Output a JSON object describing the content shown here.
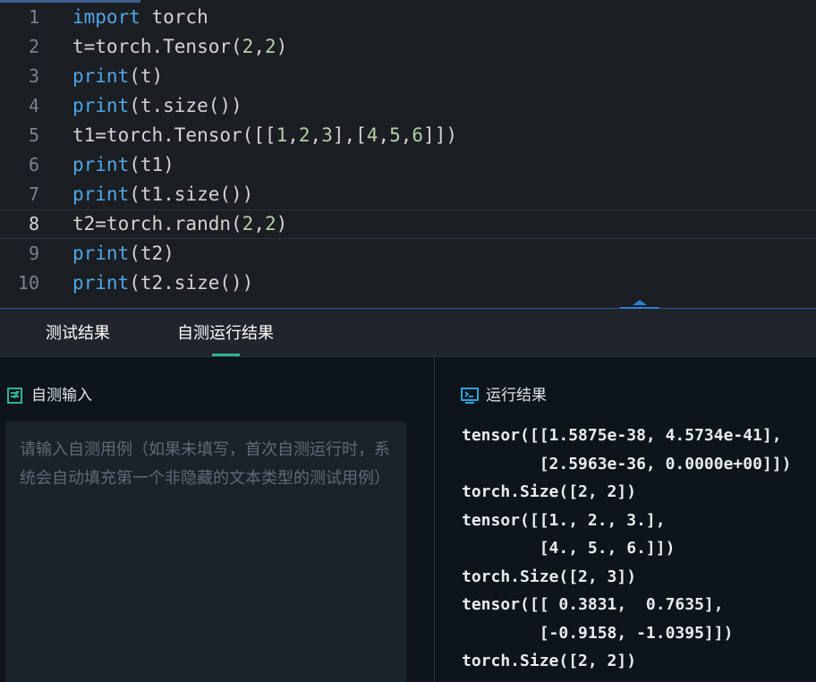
{
  "editor": {
    "lines": [
      {
        "num": "1",
        "tokens": [
          {
            "t": "import",
            "c": "kw"
          },
          {
            "t": " torch",
            "c": ""
          }
        ]
      },
      {
        "num": "2",
        "tokens": [
          {
            "t": "t=torch.Tensor(",
            "c": ""
          },
          {
            "t": "2",
            "c": "num"
          },
          {
            "t": ",",
            "c": ""
          },
          {
            "t": "2",
            "c": "num"
          },
          {
            "t": ")",
            "c": ""
          }
        ]
      },
      {
        "num": "3",
        "tokens": [
          {
            "t": "print",
            "c": "kw"
          },
          {
            "t": "(t)",
            "c": ""
          }
        ]
      },
      {
        "num": "4",
        "tokens": [
          {
            "t": "print",
            "c": "kw"
          },
          {
            "t": "(t.size())",
            "c": ""
          }
        ]
      },
      {
        "num": "5",
        "tokens": [
          {
            "t": "t1=torch.Tensor([[",
            "c": ""
          },
          {
            "t": "1",
            "c": "num"
          },
          {
            "t": ",",
            "c": ""
          },
          {
            "t": "2",
            "c": "num"
          },
          {
            "t": ",",
            "c": ""
          },
          {
            "t": "3",
            "c": "num"
          },
          {
            "t": "],[",
            "c": ""
          },
          {
            "t": "4",
            "c": "num"
          },
          {
            "t": ",",
            "c": ""
          },
          {
            "t": "5",
            "c": "num"
          },
          {
            "t": ",",
            "c": ""
          },
          {
            "t": "6",
            "c": "num"
          },
          {
            "t": "]])",
            "c": ""
          }
        ]
      },
      {
        "num": "6",
        "tokens": [
          {
            "t": "print",
            "c": "kw"
          },
          {
            "t": "(t1)",
            "c": ""
          }
        ]
      },
      {
        "num": "7",
        "tokens": [
          {
            "t": "print",
            "c": "kw"
          },
          {
            "t": "(t1.size())",
            "c": ""
          }
        ]
      },
      {
        "num": "8",
        "tokens": [
          {
            "t": "t2=torch.randn(",
            "c": ""
          },
          {
            "t": "2",
            "c": "num"
          },
          {
            "t": ",",
            "c": ""
          },
          {
            "t": "2",
            "c": "num"
          },
          {
            "t": ")",
            "c": ""
          }
        ]
      },
      {
        "num": "9",
        "tokens": [
          {
            "t": "print",
            "c": "kw"
          },
          {
            "t": "(t2)",
            "c": ""
          }
        ]
      },
      {
        "num": "10",
        "tokens": [
          {
            "t": "print",
            "c": "kw"
          },
          {
            "t": "(t2.size())",
            "c": ""
          }
        ]
      }
    ],
    "active_line": 8
  },
  "tabs": [
    {
      "label": "测试结果",
      "active": false
    },
    {
      "label": "自测运行结果",
      "active": true
    }
  ],
  "self_test": {
    "header": "自测输入",
    "icon": "edit-doc-icon",
    "placeholder": "请输入自测用例（如果未填写，首次自测运行时，系统会自动填充第一个非隐藏的文本类型的测试用例）",
    "value": ""
  },
  "run_result": {
    "header": "运行结果",
    "icon": "terminal-monitor-icon",
    "output": "tensor([[1.5875e-38, 4.5734e-41],\n        [2.5963e-36, 0.0000e+00]])\ntorch.Size([2, 2])\ntensor([[1., 2., 3.],\n        [4., 5., 6.]])\ntorch.Size([2, 3])\ntensor([[ 0.3831,  0.7635],\n        [-0.9158, -1.0395]])\ntorch.Size([2, 2])"
  },
  "colors": {
    "keyword": "#4fa6e8",
    "number": "#b5cea8",
    "accent": "#2fb394",
    "splitter": "#2a5e93"
  }
}
